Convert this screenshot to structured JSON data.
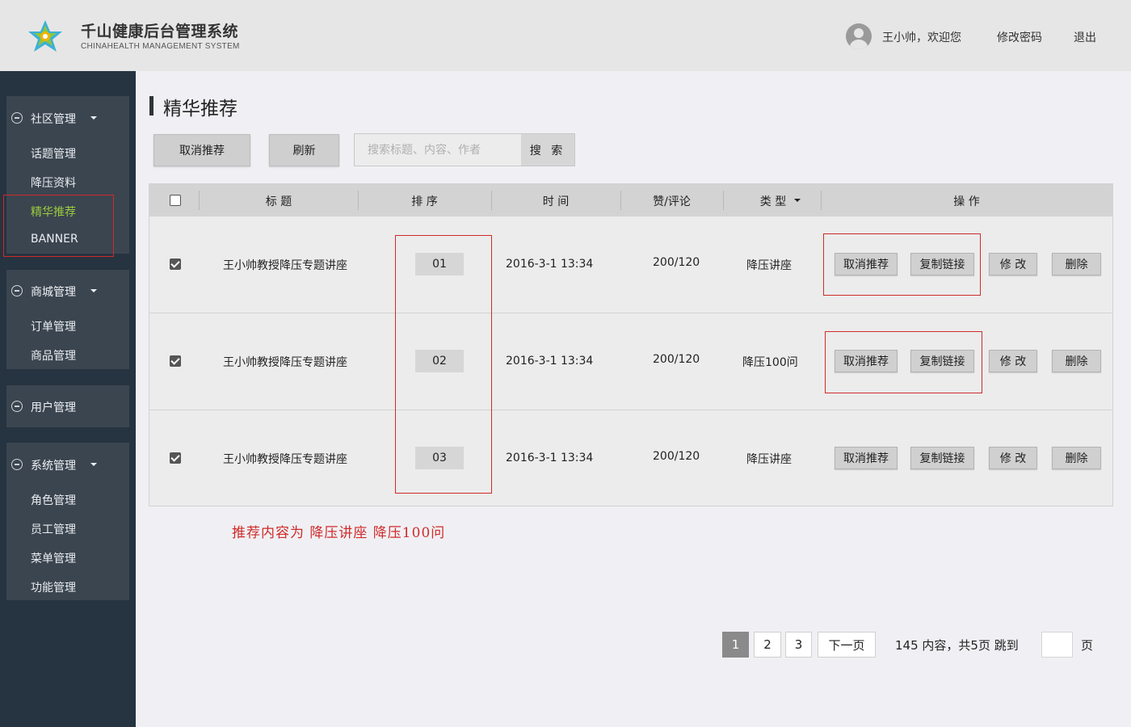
{
  "header": {
    "title": "千山健康后台管理系统",
    "subtitle": "CHINAHEALTH  MANAGEMENT SYSTEM",
    "welcome": "王小帅，欢迎您",
    "change_password": "修改密码",
    "logout": "退出",
    "logo_colors": [
      "#3cb0d8",
      "#8cc63f",
      "#f0b400",
      "#2aa8a0"
    ]
  },
  "sidebar": {
    "groups": [
      {
        "label": "社区管理",
        "items": [
          "话题管理",
          "降压资料",
          "精华推荐",
          "BANNER"
        ],
        "active": "精华推荐"
      },
      {
        "label": "商城管理",
        "items": [
          "订单管理",
          "商品管理"
        ]
      },
      {
        "label": "用户管理",
        "items": []
      },
      {
        "label": "系统管理",
        "items": [
          "角色管理",
          "员工管理",
          "菜单管理",
          "功能管理"
        ]
      }
    ]
  },
  "page": {
    "title": "精华推荐",
    "toolbar": {
      "cancel_label": "取消推荐",
      "refresh_label": "刷新"
    },
    "search": {
      "placeholder": "搜索标题、内容、作者",
      "button": "搜 索"
    }
  },
  "table": {
    "columns": [
      "标 题",
      "排 序",
      "时 间",
      "赞/评论",
      "类 型",
      "操 作"
    ],
    "header_checked": false,
    "rows": [
      {
        "checked": true,
        "title": "王小帅教授降压专题讲座",
        "order": "01",
        "time": "2016-3-1 13:34",
        "likes": "200/120",
        "type": "降压讲座"
      },
      {
        "checked": true,
        "title": "王小帅教授降压专题讲座",
        "order": "02",
        "time": "2016-3-1 13:34",
        "likes": "200/120",
        "type": "降压100问"
      },
      {
        "checked": true,
        "title": "王小帅教授降压专题讲座",
        "order": "03",
        "time": "2016-3-1 13:34",
        "likes": "200/120",
        "type": "降压讲座"
      }
    ],
    "actions": {
      "cancel": "取消推荐",
      "copy": "复制链接",
      "edit": "修 改",
      "delete": "删除"
    }
  },
  "note": "推荐内容为 降压讲座 降压100问",
  "pagination": {
    "pages": [
      "1",
      "2",
      "3"
    ],
    "current": "1",
    "next": "下一页",
    "summary": "145 内容，共5页 跳到",
    "suffix": "页"
  },
  "colors": {
    "annotation_red": "#d02a2a",
    "sidebar_bg": "#263340",
    "active_menu": "#9ccc3c"
  }
}
